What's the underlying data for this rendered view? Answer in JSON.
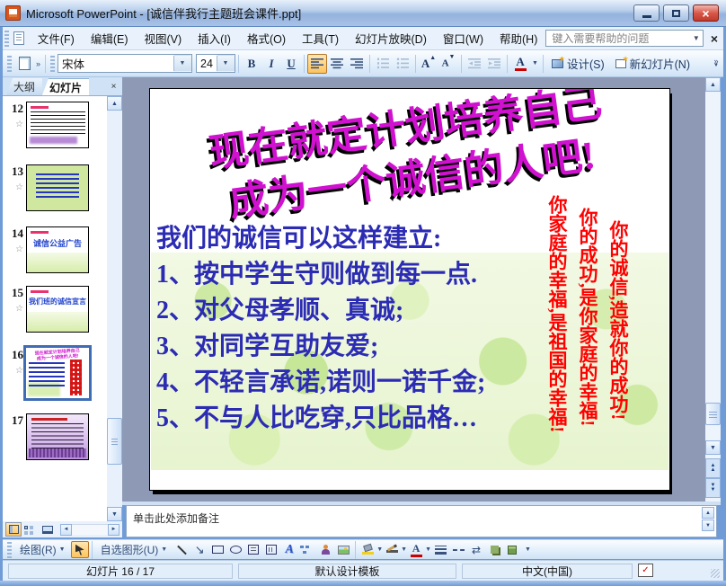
{
  "window": {
    "title": "Microsoft PowerPoint - [诚信伴我行主题班会课件.ppt]"
  },
  "icons": {
    "close": "×",
    "dropdown": "▼",
    "up": "▲",
    "down": "▼",
    "left": "◄",
    "right": "►",
    "chevron": "»",
    "star": "☆",
    "check": "✓",
    "arrow_se": "↘",
    "swap": "⇄",
    "grow_arrow": "▲",
    "shrink_arrow": "▼"
  },
  "menu": {
    "items": [
      "文件(F)",
      "编辑(E)",
      "视图(V)",
      "插入(I)",
      "格式(O)",
      "工具(T)",
      "幻灯片放映(D)",
      "窗口(W)",
      "帮助(H)"
    ],
    "help_placeholder": "键入需要帮助的问题"
  },
  "toolbar": {
    "font_name": "宋体",
    "font_size": "24",
    "bold": "B",
    "italic": "I",
    "underline": "U",
    "font_color_letter": "A",
    "grow_letter": "A",
    "shrink_letter": "A",
    "design": "设计(S)",
    "new_slide": "新幻灯片(N)"
  },
  "slides_panel": {
    "tab_outline": "大纲",
    "tab_slides": "幻灯片",
    "thumbnails": [
      {
        "num": "12"
      },
      {
        "num": "13"
      },
      {
        "num": "14",
        "title": "诚信公益广告"
      },
      {
        "num": "15",
        "title": "我们班的诚信宣言"
      },
      {
        "num": "16"
      },
      {
        "num": "17"
      }
    ]
  },
  "slide": {
    "title_line1": "现在就定计划培养自己",
    "title_line2": "成为一个诚信的人吧!",
    "body": [
      "我们的诚信可以这样建立:",
      "1、按中学生守则做到每一点.",
      "2、对父母孝顺、真诚;",
      "3、对同学互助友爱;",
      "4、不轻言承诺,诺则一诺千金;",
      "5、不与人比吃穿,只比品格…"
    ],
    "vertical_columns": [
      "你的诚信,造就你的成功!",
      "你的成功,是你家庭的幸福!",
      "你家庭的幸福,是祖国的幸福!"
    ]
  },
  "notes": {
    "placeholder": "单击此处添加备注"
  },
  "drawing": {
    "draw": "绘图(R)",
    "autoshapes": "自选图形(U)",
    "wordart_letter": "A"
  },
  "status": {
    "slide_indicator": "幻灯片 16 / 17",
    "design_template": "默认设计模板",
    "language": "中文(中国)"
  }
}
